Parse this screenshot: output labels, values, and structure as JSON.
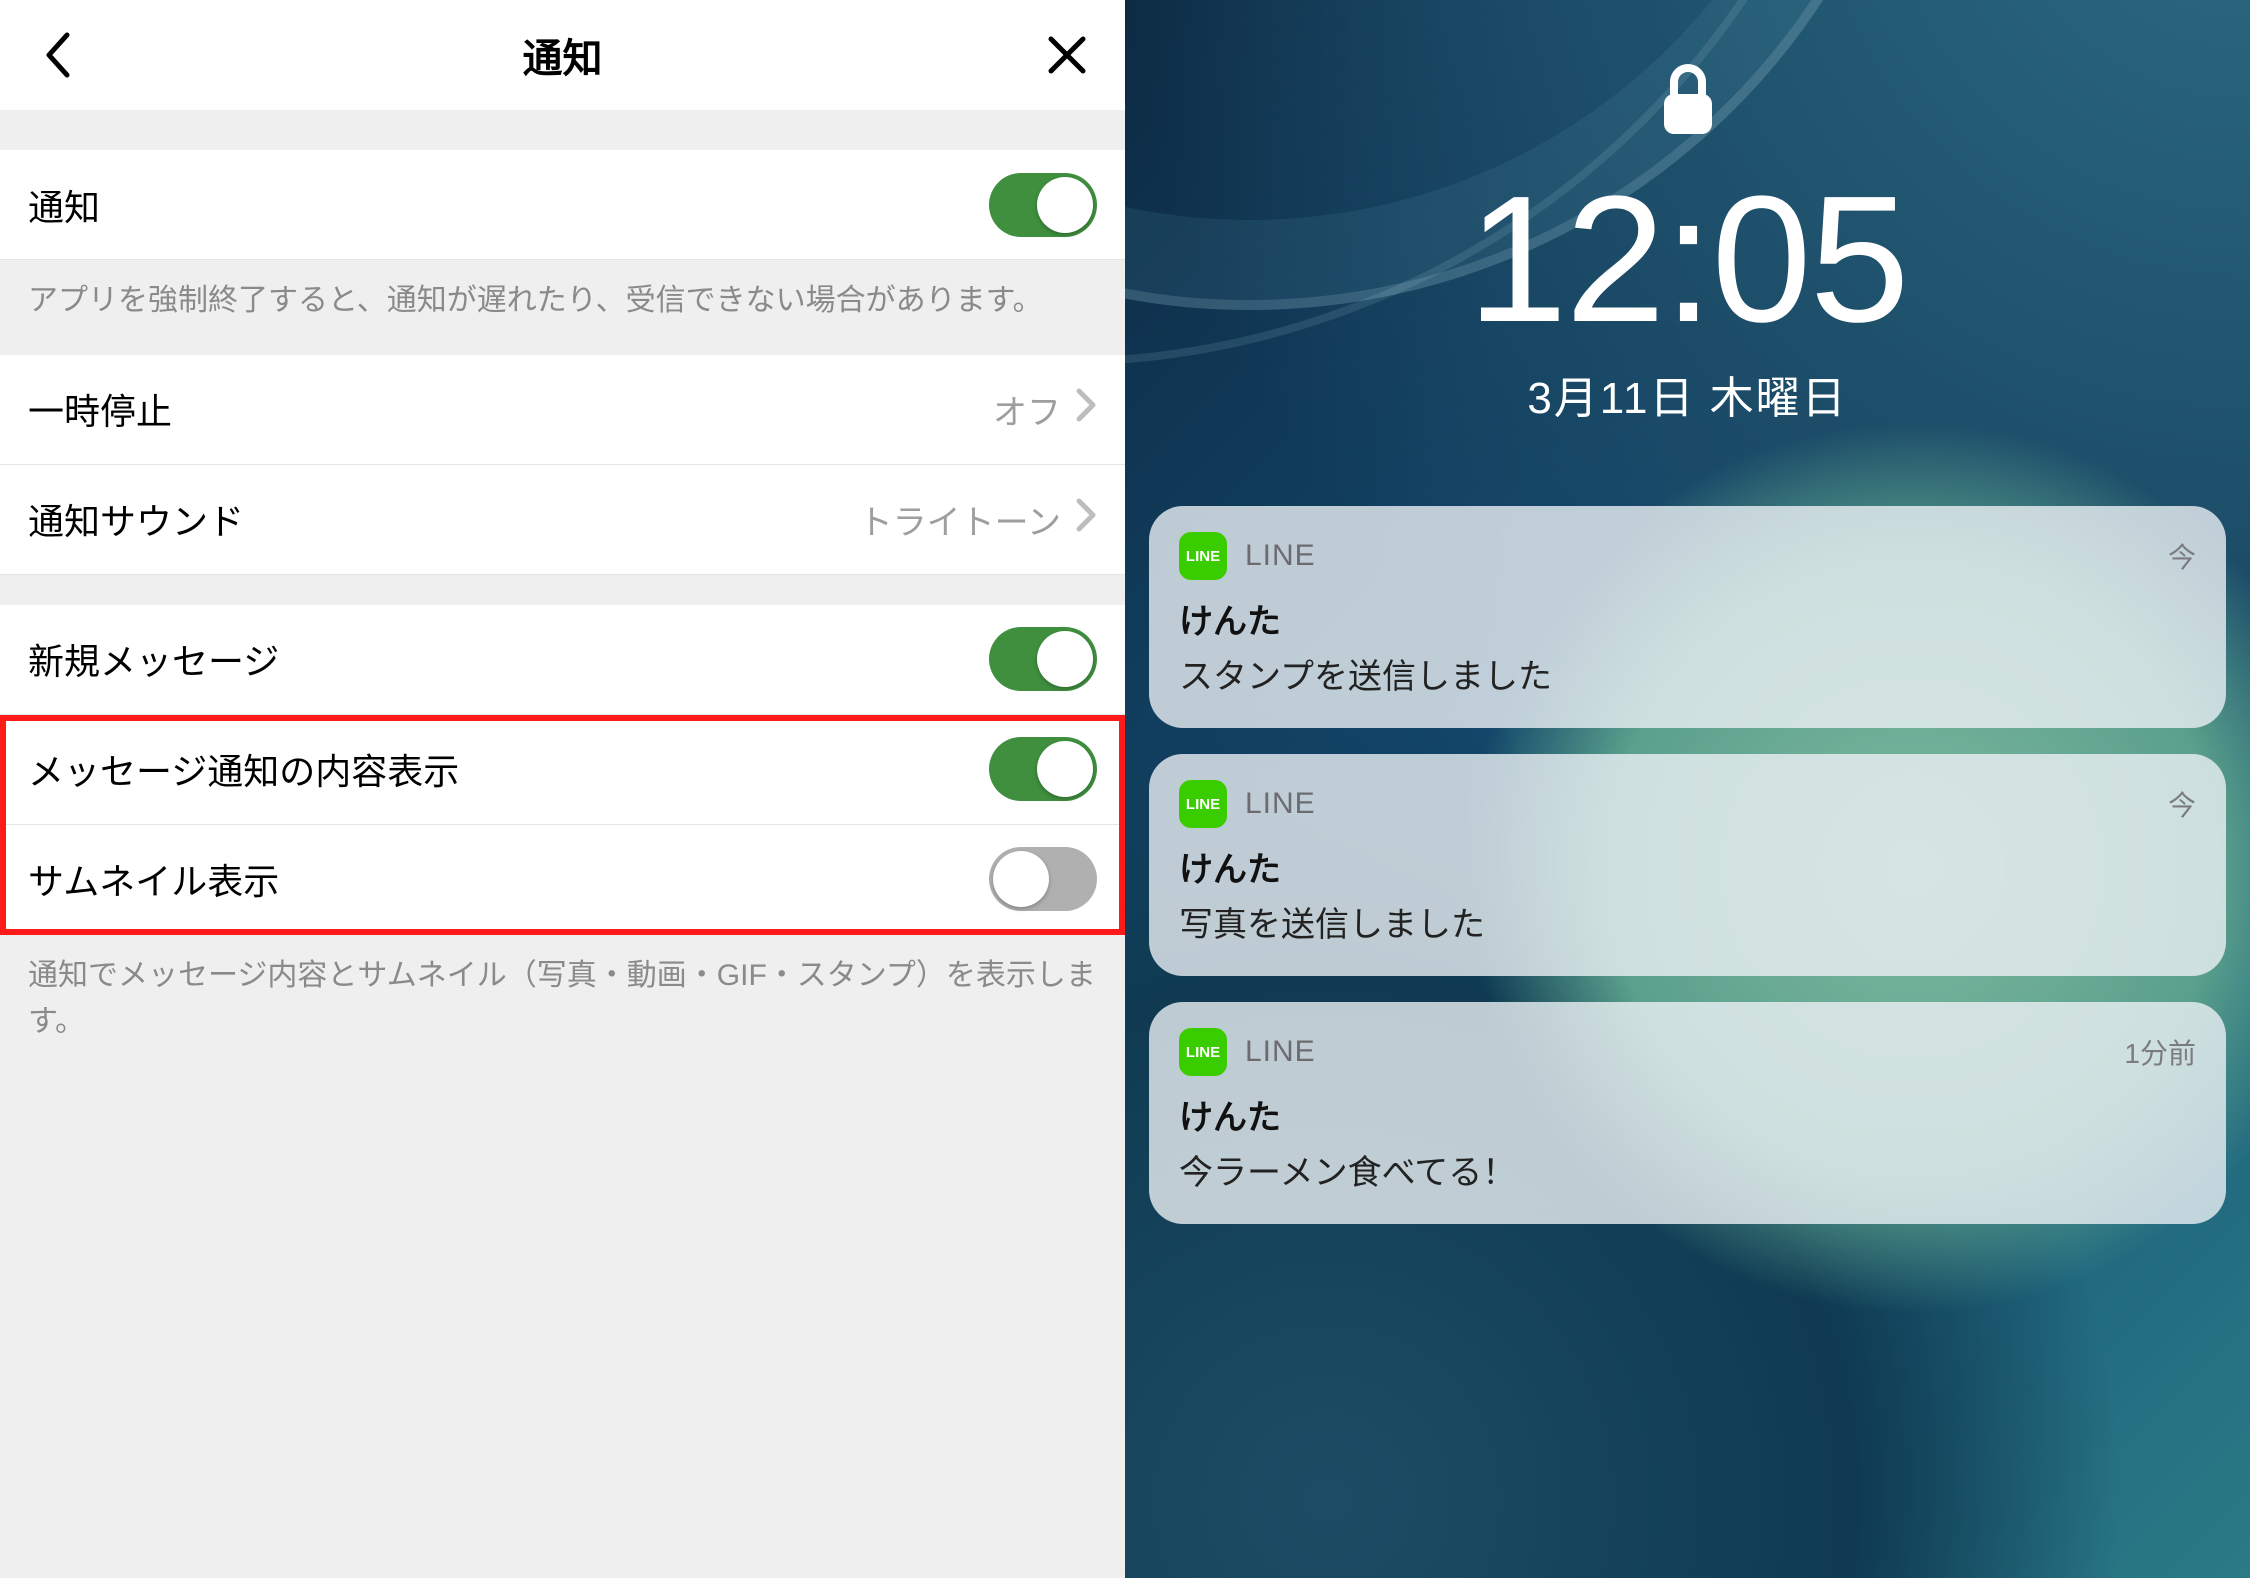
{
  "settings": {
    "header_title": "通知",
    "rows": {
      "notify": {
        "label": "通知",
        "on": true
      },
      "notify_helper": "アプリを強制終了すると、通知が遅れたり、受信できない場合があります。",
      "pause": {
        "label": "一時停止",
        "value": "オフ"
      },
      "sound": {
        "label": "通知サウンド",
        "value": "トライトーン"
      },
      "new_message": {
        "label": "新規メッセージ",
        "on": true
      },
      "show_content": {
        "label": "メッセージ通知の内容表示",
        "on": true
      },
      "show_thumb": {
        "label": "サムネイル表示",
        "on": false
      },
      "thumb_helper": "通知でメッセージ内容とサムネイル（写真・動画・GIF・スタンプ）を表示します。"
    },
    "colors": {
      "toggle_on": "#3f8f3f",
      "highlight": "#ff1a1a"
    }
  },
  "lockscreen": {
    "time": "12:05",
    "date": "3月11日 木曜日",
    "app_badge_text": "LINE",
    "notifications": [
      {
        "app": "LINE",
        "time": "今",
        "sender": "けんた",
        "body": "スタンプを送信しました"
      },
      {
        "app": "LINE",
        "time": "今",
        "sender": "けんた",
        "body": "写真を送信しました"
      },
      {
        "app": "LINE",
        "time": "1分前",
        "sender": "けんた",
        "body": "今ラーメン食べてる！"
      }
    ]
  }
}
